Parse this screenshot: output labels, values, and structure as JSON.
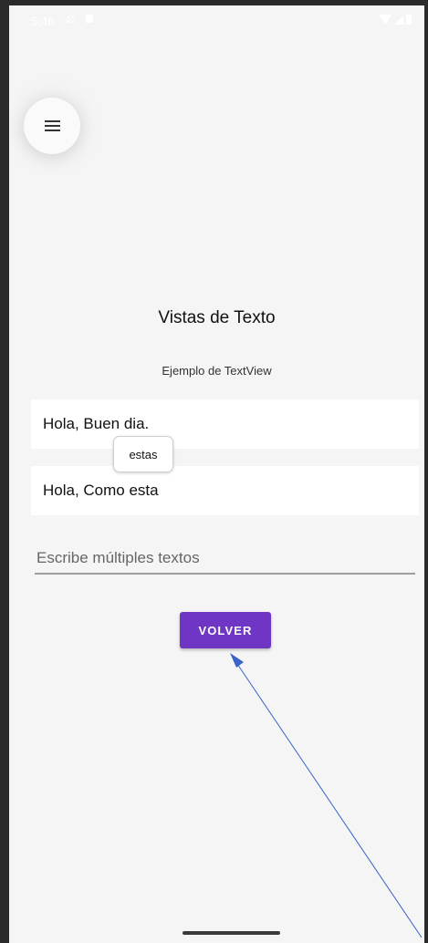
{
  "statusbar": {
    "time": "5:46",
    "dnd_icon": "do-not-disturb-icon",
    "lock_icon": "lock-icon",
    "wifi_icon": "wifi-icon",
    "signal_icon": "signal-icon",
    "battery_icon": "battery-icon"
  },
  "menu": {
    "icon": "menu-icon"
  },
  "content": {
    "title": "Vistas de Texto",
    "subtitle": "Ejemplo de TextView",
    "textbox1": "Hola, Buen dia.",
    "tooltip": "estas",
    "textbox2": "Hola, Como esta",
    "input_placeholder": "Escribe múltiples textos",
    "input_value": "",
    "button_label": "VOLVER"
  },
  "colors": {
    "background": "#f5f5f5",
    "button": "#6f35c4",
    "annotation_arrow": "#3a62c8"
  }
}
